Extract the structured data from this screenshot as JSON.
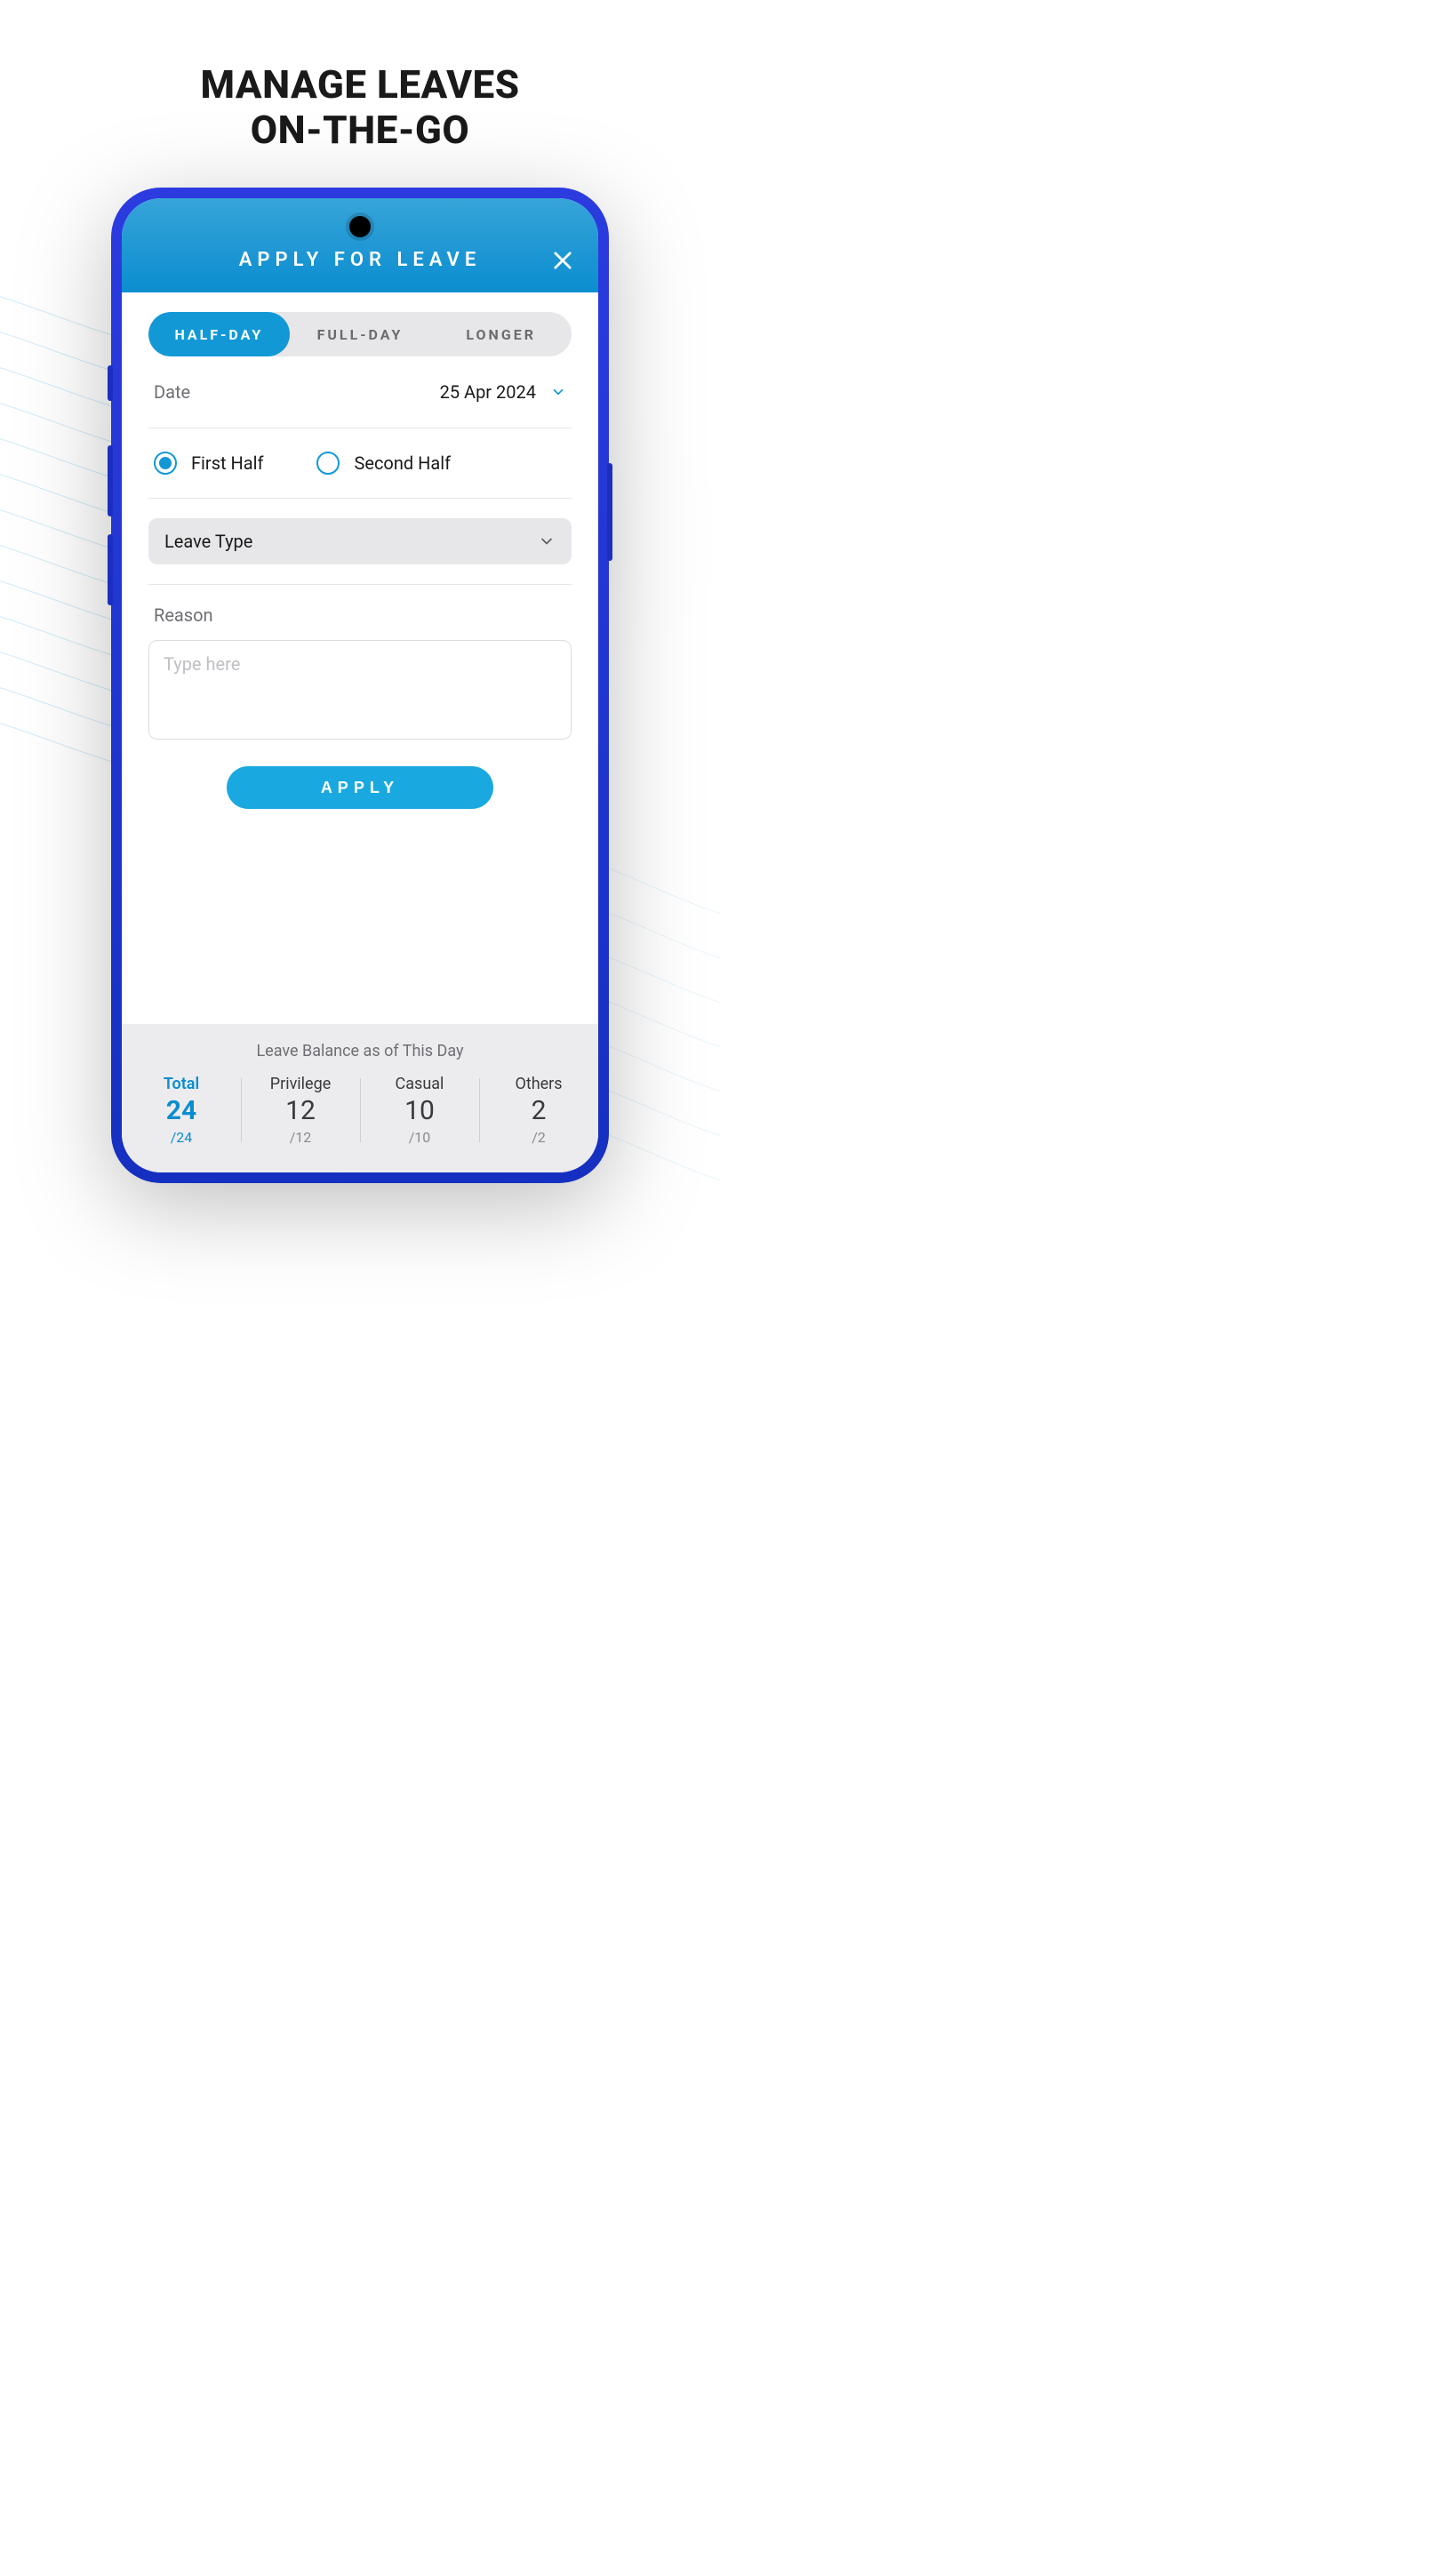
{
  "promo": {
    "title_line1": "MANAGE LEAVES",
    "title_line2": "ON-THE-GO"
  },
  "header": {
    "title": "APPLY FOR LEAVE"
  },
  "tabs": {
    "half": "HALF-DAY",
    "full": "FULL-DAY",
    "longer": "LONGER"
  },
  "date": {
    "label": "Date",
    "value": "25 Apr 2024"
  },
  "half_options": {
    "first": "First Half",
    "second": "Second Half"
  },
  "leave_type": {
    "placeholder": "Leave Type"
  },
  "reason": {
    "label": "Reason",
    "placeholder": "Type here"
  },
  "apply_label": "APPLY",
  "balances": {
    "title": "Leave Balance as of This Day",
    "cols": [
      {
        "label": "Total",
        "value": "24",
        "den": "/24"
      },
      {
        "label": "Privilege",
        "value": "12",
        "den": "/12"
      },
      {
        "label": "Casual",
        "value": "10",
        "den": "/10"
      },
      {
        "label": "Others",
        "value": "2",
        "den": "/2"
      }
    ]
  }
}
